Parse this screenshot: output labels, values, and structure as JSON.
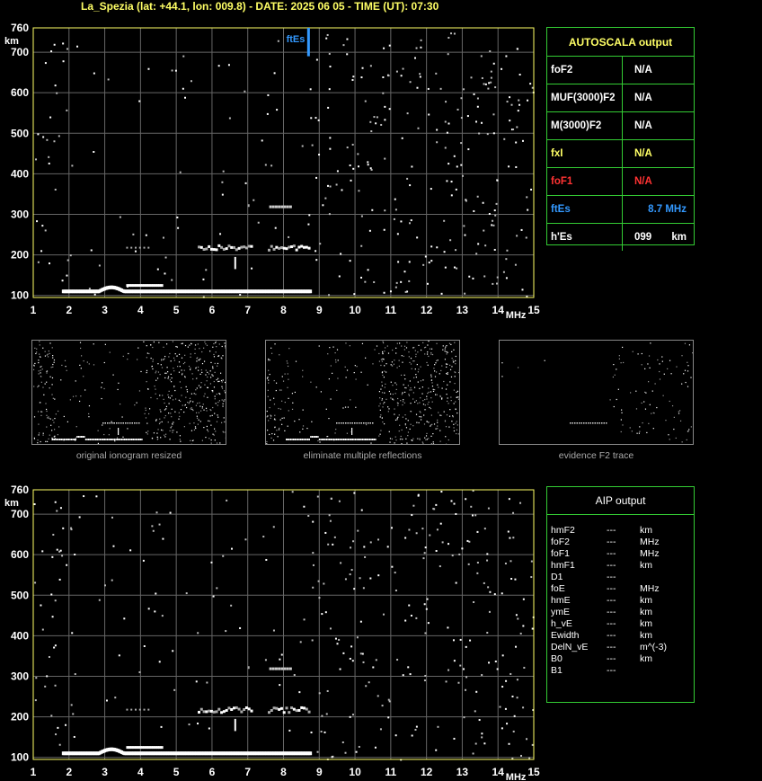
{
  "header": {
    "title": "La_Spezia (lat: +44.1, lon: 009.8) - DATE: 2025 06 05 - TIME (UT): 07:30"
  },
  "colors": {
    "title": "#ffff66",
    "axis_frame": "#ffff66",
    "axis_text": "#ffffff",
    "grid": "#666666",
    "table_border": "#33cc33",
    "label_default": "#ffffff",
    "label_foF1": "#ff3333",
    "label_ftEs": "#3399ff",
    "echo_trace": "#ffffff",
    "noise": "#bbbbbb"
  },
  "autoscala": {
    "title": "AUTOSCALA output",
    "rows": [
      {
        "label": "foF2",
        "value": "N/A",
        "unit": "",
        "color": "#ffffff"
      },
      {
        "label": "MUF(3000)F2",
        "value": "N/A",
        "unit": "",
        "color": "#ffffff"
      },
      {
        "label": "M(3000)F2",
        "value": "N/A",
        "unit": "",
        "color": "#ffffff"
      },
      {
        "label": "fxI",
        "value": "N/A",
        "unit": "",
        "color": "#ffff66"
      },
      {
        "label": "foF1",
        "value": "N/A",
        "unit": "",
        "color": "#ff3333"
      },
      {
        "label": "ftEs",
        "value": "8.7 MHz",
        "unit": "",
        "color": "#3399ff"
      },
      {
        "label": "h'Es",
        "value": "099",
        "unit": "km",
        "color": "#ffffff"
      }
    ]
  },
  "aip": {
    "title": "AIP output",
    "rows": [
      {
        "param": "hmF2",
        "value": "---",
        "unit": "km"
      },
      {
        "param": "foF2",
        "value": "---",
        "unit": "MHz"
      },
      {
        "param": "foF1",
        "value": "---",
        "unit": "MHz"
      },
      {
        "param": "hmF1",
        "value": "---",
        "unit": "km"
      },
      {
        "param": "D1",
        "value": "---",
        "unit": ""
      },
      {
        "param": "foE",
        "value": "---",
        "unit": "MHz"
      },
      {
        "param": "hmE",
        "value": "---",
        "unit": "km"
      },
      {
        "param": "ymE",
        "value": "---",
        "unit": "km"
      },
      {
        "param": "h_vE",
        "value": "---",
        "unit": "km"
      },
      {
        "param": "Ewidth",
        "value": "---",
        "unit": "km"
      },
      {
        "param": "DelN_vE",
        "value": "---",
        "unit": "m^(-3)"
      },
      {
        "param": "B0",
        "value": "---",
        "unit": "km"
      },
      {
        "param": "B1",
        "value": "---",
        "unit": ""
      }
    ]
  },
  "captions": {
    "thumb1": "original ionogram resized",
    "thumb2": "eliminate multiple reflections",
    "thumb3": "evidence F2 trace"
  },
  "chart_data": [
    {
      "type": "scatter",
      "name": "ionogram-top",
      "xlabel": "MHz",
      "ylabel": "km",
      "xlim": [
        1,
        15
      ],
      "ylim": [
        95,
        760
      ],
      "xticks": [
        1,
        2,
        3,
        4,
        5,
        6,
        7,
        8,
        9,
        10,
        11,
        12,
        13,
        14,
        15
      ],
      "yticks": [
        100,
        200,
        300,
        400,
        500,
        600,
        700,
        760
      ],
      "grid": true,
      "ftEs_marker": {
        "label": "ftEs",
        "frequency": 8.7,
        "height_range": [
          690,
          760
        ]
      },
      "es_trace": {
        "x_range": [
          1.8,
          8.75
        ],
        "height": 110
      },
      "es_second_hop": {
        "x_range": [
          5.6,
          8.7
        ],
        "height": 220
      },
      "es_third_hop": {
        "x_range": [
          7.6,
          8.2
        ],
        "height": 322
      }
    },
    {
      "type": "scatter",
      "name": "ionogram-bottom",
      "xlabel": "MHz",
      "ylabel": "km",
      "xlim": [
        1,
        15
      ],
      "ylim": [
        95,
        760
      ],
      "xticks": [
        1,
        2,
        3,
        4,
        5,
        6,
        7,
        8,
        9,
        10,
        11,
        12,
        13,
        14,
        15
      ],
      "yticks": [
        100,
        200,
        300,
        400,
        500,
        600,
        700,
        760
      ],
      "grid": true,
      "es_trace": {
        "x_range": [
          1.8,
          8.75
        ],
        "height": 110
      },
      "es_second_hop": {
        "x_range": [
          5.6,
          8.7
        ],
        "height": 220
      },
      "es_third_hop": {
        "x_range": [
          7.6,
          8.2
        ],
        "height": 322
      }
    }
  ]
}
